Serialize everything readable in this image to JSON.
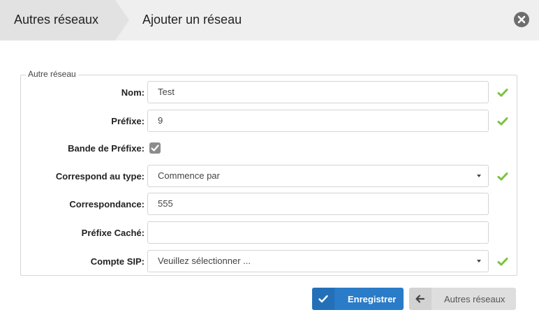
{
  "header": {
    "breadcrumb_parent": "Autres réseaux",
    "page_title": "Ajouter un réseau",
    "close_icon": "close-icon"
  },
  "form": {
    "legend": "Autre réseau",
    "fields": {
      "nom": {
        "label": "Nom:",
        "value": "Test",
        "valid": true
      },
      "prefixe": {
        "label": "Préfixe:",
        "value": "9",
        "valid": true
      },
      "bande_prefixe": {
        "label": "Bande de Préfixe:",
        "checked": true
      },
      "correspond_type": {
        "label": "Correspond au type:",
        "value": "Commence par",
        "valid": true
      },
      "correspondance": {
        "label": "Correspondance:",
        "value": "555"
      },
      "prefixe_cache": {
        "label": "Préfixe Caché:",
        "value": ""
      },
      "compte_sip": {
        "label": "Compte SIP:",
        "value": "Veuillez sélectionner ...",
        "valid": true
      }
    }
  },
  "actions": {
    "save_label": "Enregistrer",
    "back_label": "Autres réseaux"
  },
  "colors": {
    "valid_check": "#7cc242",
    "primary_button": "#2a7bc8",
    "secondary_button": "#dedede"
  }
}
